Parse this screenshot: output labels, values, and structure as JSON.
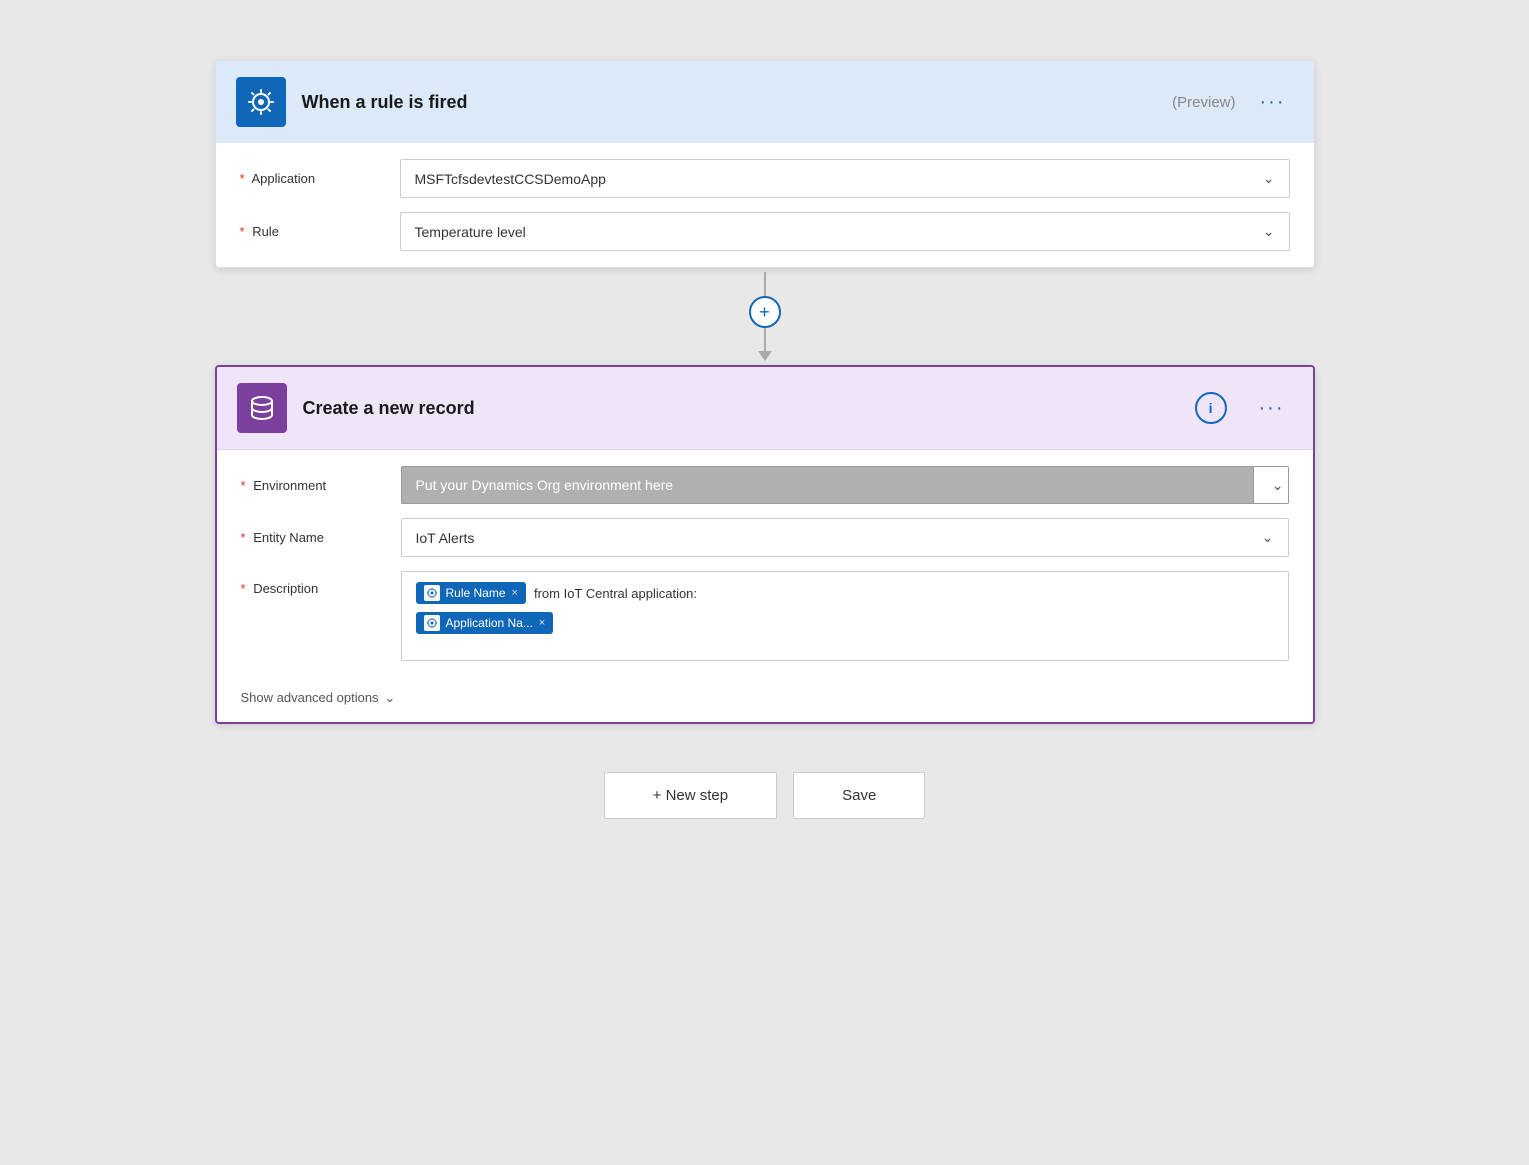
{
  "trigger_card": {
    "title": "When a rule is fired",
    "preview_label": "(Preview)",
    "dots": "···",
    "application_label": "Application",
    "application_value": "MSFTcfsdevtestCCSDemoApp",
    "rule_label": "Rule",
    "rule_value": "Temperature level"
  },
  "connector": {
    "plus_symbol": "+"
  },
  "action_card": {
    "title": "Create a new record",
    "dots": "···",
    "info_symbol": "i",
    "environment_label": "Environment",
    "environment_placeholder": "Put your Dynamics Org environment here",
    "entity_label": "Entity Name",
    "entity_value": "IoT Alerts",
    "description_label": "Description",
    "tag1_label": "Rule Name",
    "tag1_x": "×",
    "tag2_label": "Application Na...",
    "tag2_x": "×",
    "desc_text": "from IoT Central application:",
    "advanced_label": "Show advanced options"
  },
  "buttons": {
    "new_step": "+ New step",
    "save": "Save"
  }
}
